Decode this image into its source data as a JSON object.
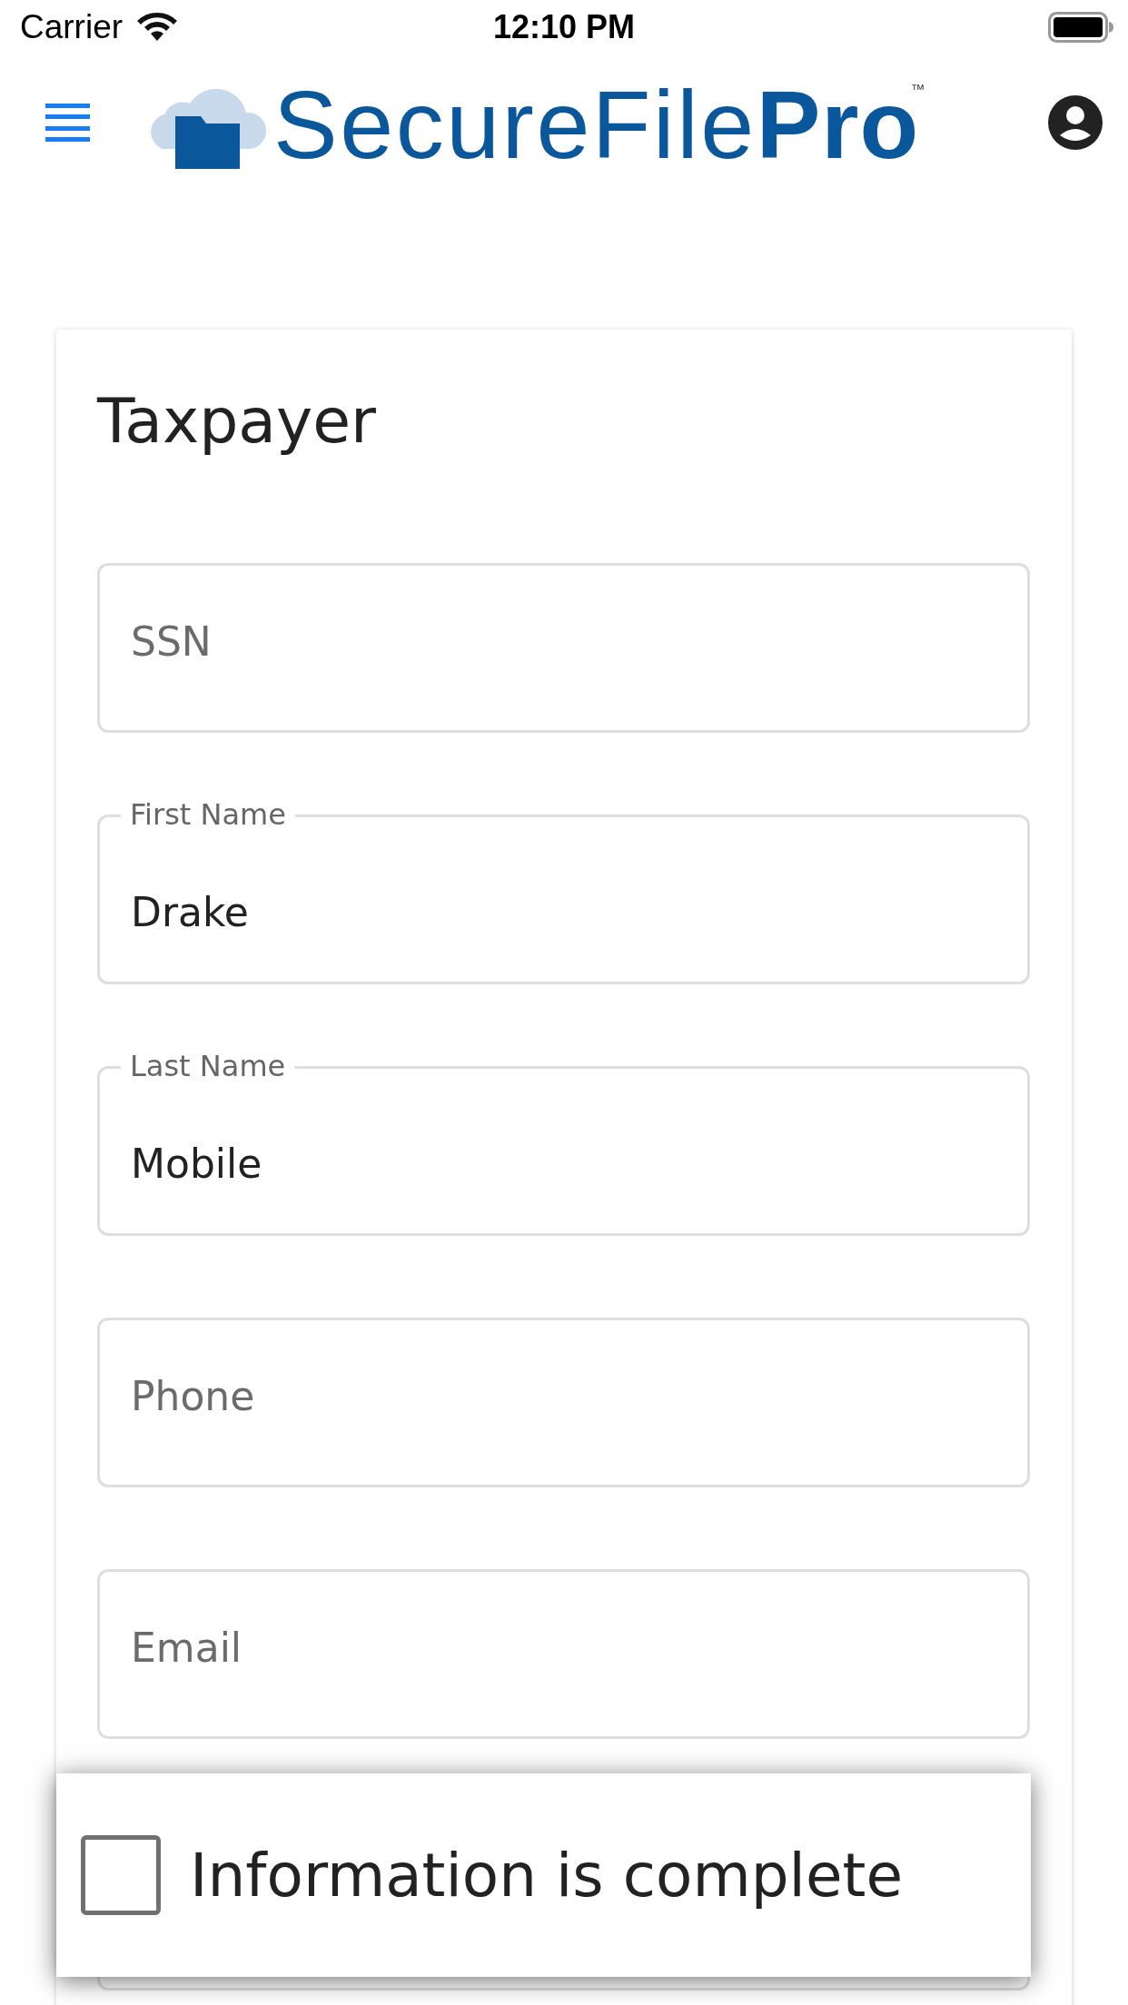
{
  "status_bar": {
    "carrier": "Carrier",
    "time": "12:10 PM"
  },
  "header": {
    "logo": "SecureFile**Pro**$^{™}$"
  },
  "card": {
    "title": "Taxpayer",
    "fields": [
      {
        "kind": "placeholder",
        "placeholder": "SSN"
      },
      {
        "kind": "floating",
        "label": "First Name",
        "value": "Drake"
      },
      {
        "kind": "floating",
        "label": "Last Name",
        "value": "Mobile"
      },
      {
        "kind": "placeholder",
        "placeholder": "Phone"
      },
      {
        "kind": "placeholder",
        "placeholder": "Email"
      },
      {
        "kind": "blank"
      }
    ]
  },
  "completion_bar": {
    "label": "Information is complete",
    "checked": false
  }
}
